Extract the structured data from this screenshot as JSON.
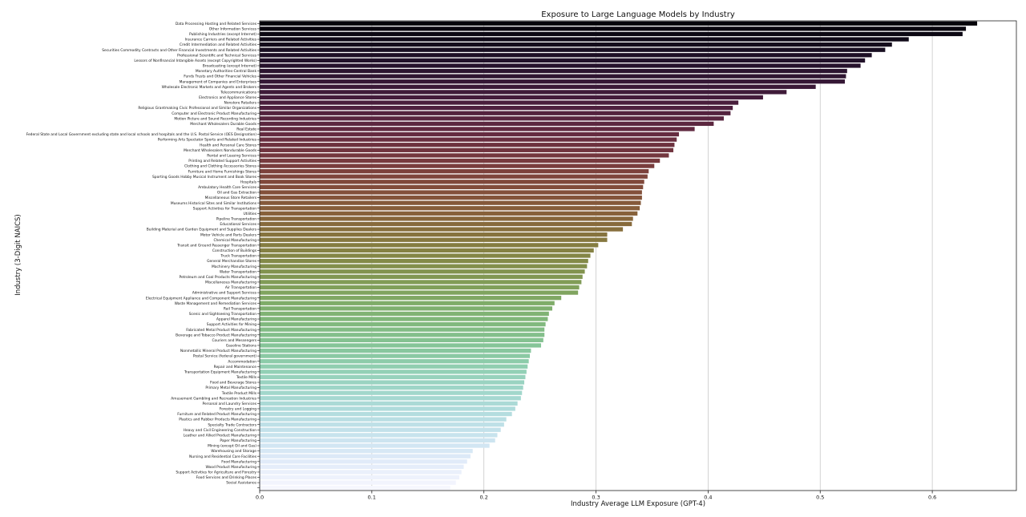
{
  "chart_data": {
    "type": "bar",
    "orientation": "horizontal",
    "title": "Exposure to Large Language Models by Industry",
    "xlabel": "Industry Average LLM Exposure (GPT-4)",
    "ylabel": "Industry (3-Digit NAICS)",
    "xlim": [
      0,
      0.675
    ],
    "xticks": [
      0.0,
      0.1,
      0.2,
      0.3,
      0.4,
      0.5,
      0.6
    ],
    "xtick_labels": [
      "0.0",
      "0.1",
      "0.2",
      "0.3",
      "0.4",
      "0.5",
      "0.6"
    ],
    "grid": "vertical",
    "colormap": "cubehelix (dark to light)",
    "categories": [
      "Data Processing Hosting and Related Services",
      "Other Information Services",
      "Publishing Industries (except Internet)",
      "Insurance Carriers and Related Activities",
      "Credit Intermediation and Related Activities",
      "Securities Commodity Contracts and Other Financial Investments and Related Activities",
      "Professional Scientific and Technical Services",
      "Lessors of Nonfinancial Intangible Assets (except Copyrighted Works)",
      "Broadcasting (except Internet)",
      "Monetary Authorities-Central Bank",
      "Funds Trusts and Other Financial Vehicles",
      "Management of Companies and Enterprises",
      "Wholesale Electronic Markets and Agents and Brokers",
      "Telecommunications",
      "Electronics and Appliance Stores",
      "Nonstore Retailers",
      "Religious Grantmaking Civic Professional and Similar Organizations",
      "Computer and Electronic Product Manufacturing",
      "Motion Picture and Sound Recording Industries",
      "Merchant Wholesalers Durable Goods",
      "Real Estate",
      "Federal State and Local Government excluding state and local schools and hospitals and the U.S. Postal Service (OES Designation)",
      "Performing Arts Spectator Sports and Related Industries",
      "Health and Personal Care Stores",
      "Merchant Wholesalers Nondurable Goods",
      "Rental and Leasing Services",
      "Printing and Related Support Activities",
      "Clothing and Clothing Accessories Stores",
      "Furniture and Home Furnishings Stores",
      "Sporting Goods Hobby Musical Instrument and Book Stores",
      "Hospitals",
      "Ambulatory Health Care Services",
      "Oil and Gas Extraction",
      "Miscellaneous Store Retailers",
      "Museums Historical Sites and Similar Institutions",
      "Support Activities for Transportation",
      "Utilities",
      "Pipeline Transportation",
      "Educational Services",
      "Building Material and Garden Equipment and Supplies Dealers",
      "Motor Vehicle and Parts Dealers",
      "Chemical Manufacturing",
      "Transit and Ground Passenger Transportation",
      "Construction of Buildings",
      "Truck Transportation",
      "General Merchandise Stores",
      "Machinery Manufacturing",
      "Water Transportation",
      "Petroleum and Coal Products Manufacturing",
      "Miscellaneous Manufacturing",
      "Air Transportation",
      "Administrative and Support Services",
      "Electrical Equipment Appliance and Component Manufacturing",
      "Waste Management and Remediation Services",
      "Rail Transportation",
      "Scenic and Sightseeing Transportation",
      "Apparel Manufacturing",
      "Support Activities for Mining",
      "Fabricated Metal Product Manufacturing",
      "Beverage and Tobacco Product Manufacturing",
      "Couriers and Messengers",
      "Gasoline Stations",
      "Nonmetallic Mineral Product Manufacturing",
      "Postal Service (federal government)",
      "Accommodation",
      "Repair and Maintenance",
      "Transportation Equipment Manufacturing",
      "Textile Mills",
      "Food and Beverage Stores",
      "Primary Metal Manufacturing",
      "Textile Product Mills",
      "Amusement Gambling and Recreation Industries",
      "Personal and Laundry Services",
      "Forestry and Logging",
      "Furniture and Related Product Manufacturing",
      "Plastics and Rubber Products Manufacturing",
      "Specialty Trade Contractors",
      "Heavy and Civil Engineering Construction",
      "Leather and Allied Product Manufacturing",
      "Paper Manufacturing",
      "Mining (except Oil and Gas)",
      "Warehousing and Storage",
      "Nursing and Residential Care Facilities",
      "Food Manufacturing",
      "Wood Product Manufacturing",
      "Support Activities for Agriculture and Forestry",
      "Food Services and Drinking Places",
      "Social Assistance"
    ],
    "values": [
      0.64,
      0.63,
      0.627,
      0.579,
      0.564,
      0.558,
      0.546,
      0.54,
      0.536,
      0.524,
      0.523,
      0.522,
      0.496,
      0.47,
      0.449,
      0.427,
      0.422,
      0.42,
      0.414,
      0.405,
      0.388,
      0.374,
      0.372,
      0.37,
      0.369,
      0.365,
      0.357,
      0.352,
      0.347,
      0.346,
      0.343,
      0.342,
      0.341,
      0.341,
      0.34,
      0.339,
      0.337,
      0.333,
      0.332,
      0.324,
      0.31,
      0.31,
      0.302,
      0.298,
      0.295,
      0.293,
      0.292,
      0.29,
      0.288,
      0.287,
      0.285,
      0.284,
      0.269,
      0.263,
      0.261,
      0.258,
      0.257,
      0.255,
      0.254,
      0.254,
      0.253,
      0.251,
      0.242,
      0.241,
      0.24,
      0.239,
      0.238,
      0.237,
      0.236,
      0.235,
      0.234,
      0.233,
      0.23,
      0.228,
      0.225,
      0.22,
      0.218,
      0.215,
      0.212,
      0.21,
      0.205,
      0.19,
      0.188,
      0.185,
      0.182,
      0.18,
      0.178,
      0.175,
      0.17
    ]
  }
}
